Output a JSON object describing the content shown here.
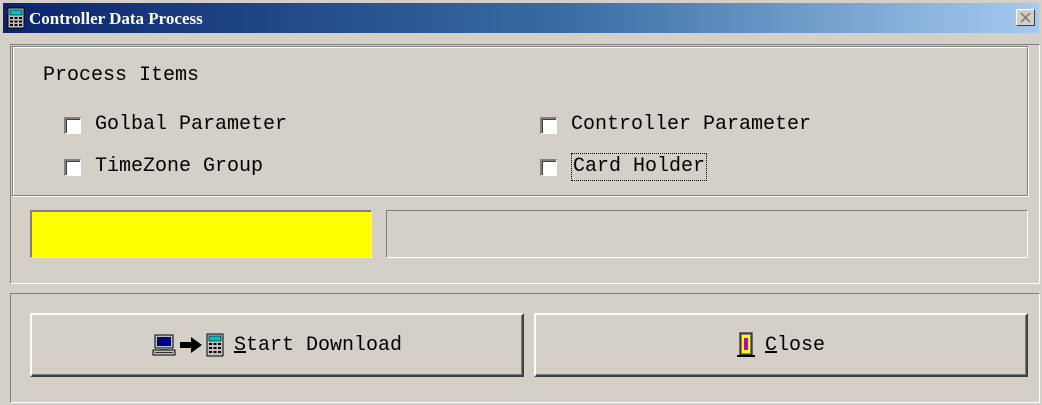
{
  "window": {
    "title": "Controller Data Process",
    "title_icon": "calculator-icon",
    "close_icon": "close-icon"
  },
  "group": {
    "legend": "Process Items",
    "items": [
      {
        "label": "Golbal Parameter",
        "checked": false
      },
      {
        "label": "Controller Parameter",
        "checked": false
      },
      {
        "label": "TimeZone Group",
        "checked": false
      },
      {
        "label": "Card Holder",
        "checked": false,
        "focused": true
      }
    ]
  },
  "progress": {
    "left_color": "#ffff00",
    "right_text": ""
  },
  "buttons": {
    "start": {
      "mnemonic": "S",
      "rest": "tart Download",
      "icons": [
        "computer-icon",
        "arrow-right-icon",
        "calculator-icon"
      ]
    },
    "close": {
      "mnemonic": "C",
      "rest": "lose",
      "icon": "exit-door-icon"
    }
  },
  "colors": {
    "face": "#d4d0c8",
    "title_start": "#0a246a",
    "title_end": "#a6caf0",
    "progress_fill": "#ffff00"
  }
}
